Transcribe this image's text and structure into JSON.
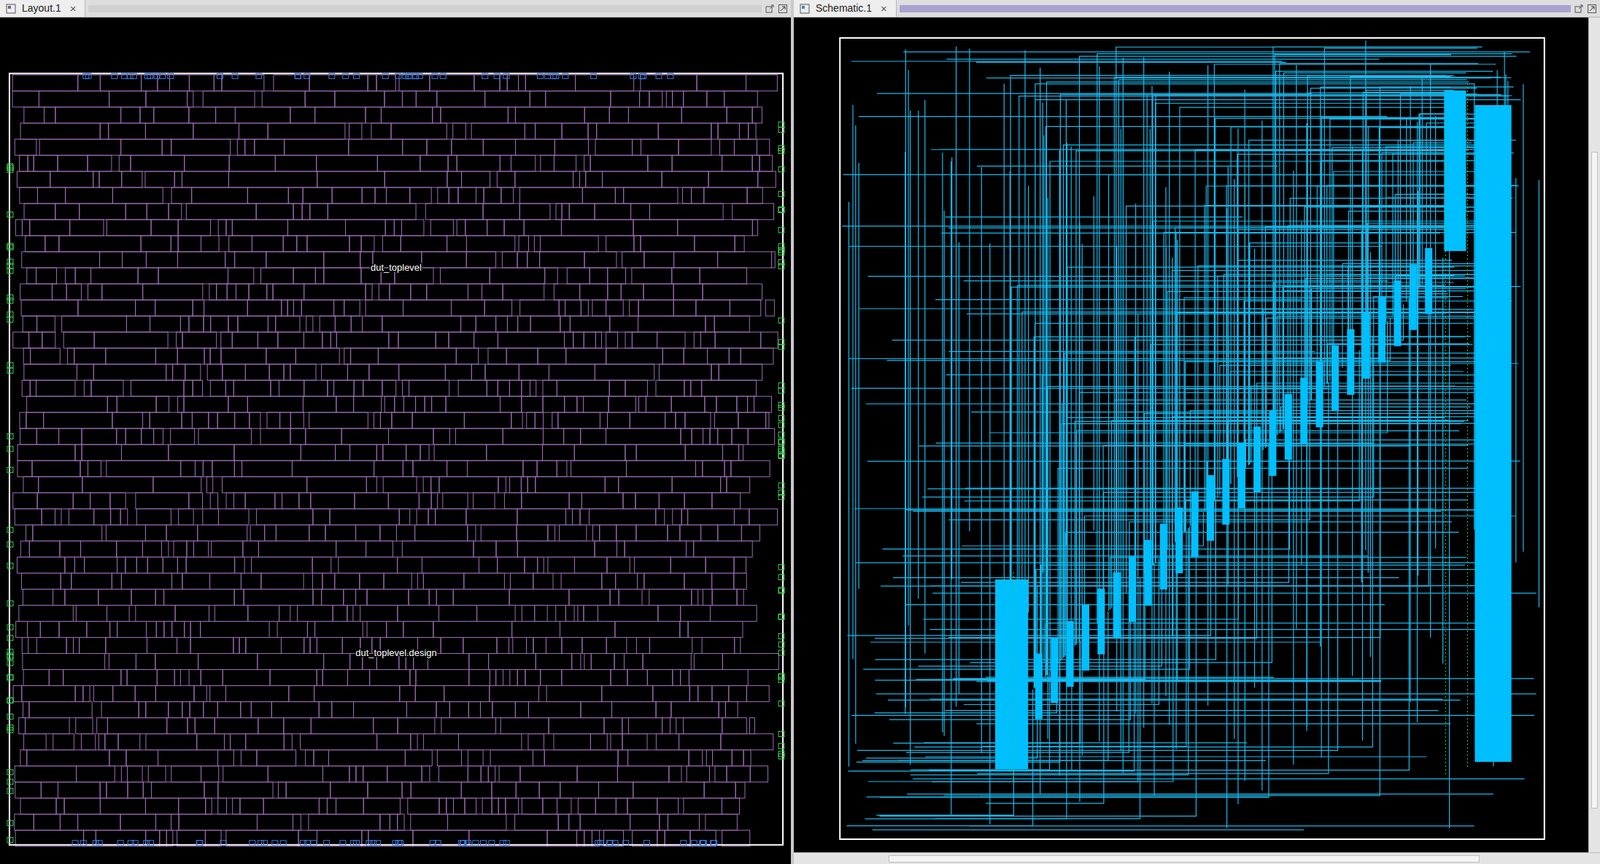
{
  "panels": [
    {
      "tab": {
        "title": "Layout.1",
        "close": "×",
        "selected": true
      },
      "focused": false,
      "labels": [
        "dut_toplevel",
        "dut_toplevel.design"
      ]
    },
    {
      "tab": {
        "title": "Schematic.1",
        "close": "×",
        "selected": true
      },
      "focused": true,
      "labels": []
    }
  ]
}
